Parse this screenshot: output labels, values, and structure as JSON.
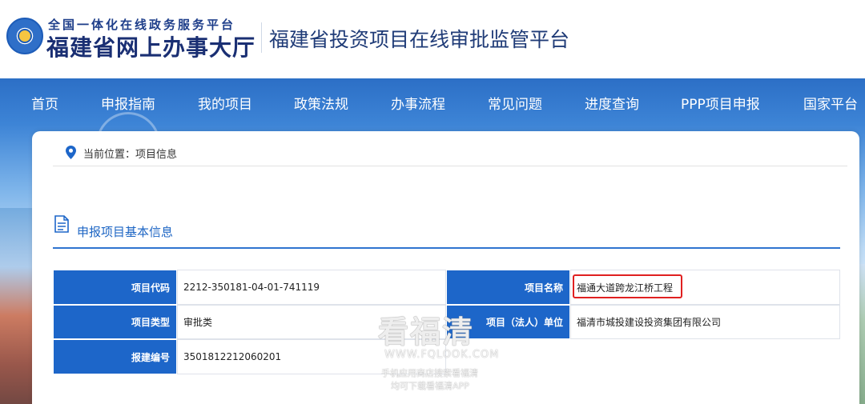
{
  "header": {
    "logo_top": "全国一体化在线政务服务平台",
    "logo_main": "福建省网上办事大厅",
    "platform_title": "福建省投资项目在线审批监管平台"
  },
  "nav": {
    "items": [
      "首页",
      "申报指南",
      "我的项目",
      "政策法规",
      "办事流程",
      "常见问题",
      "进度查询",
      "PPP项目申报",
      "国家平台"
    ]
  },
  "breadcrumb": {
    "text": "当前位置：项目信息"
  },
  "section": {
    "title": "申报项目基本信息"
  },
  "project_table": {
    "rows": [
      {
        "label1": "项目代码",
        "value1": "2212-350181-04-01-741119",
        "label2": "项目名称",
        "value2": "福通大道跨龙江桥工程"
      },
      {
        "label1": "项目类型",
        "value1": "审批类",
        "label2": "项目（法人）单位",
        "value2": "福清市城投建设投资集团有限公司"
      },
      {
        "label1": "报建编号",
        "value1": "3501812212060201"
      }
    ]
  },
  "watermark": {
    "brand": "看福清",
    "url": "WWW.FQLOOK.COM",
    "line1": "手机应用商店搜索看福清",
    "line2": "均可下载看福清APP"
  },
  "colors": {
    "nav_blue": "#2c6fc6",
    "label_blue": "#1d66c9",
    "section_blue": "#1e66c4",
    "highlight_red": "#e02020"
  }
}
